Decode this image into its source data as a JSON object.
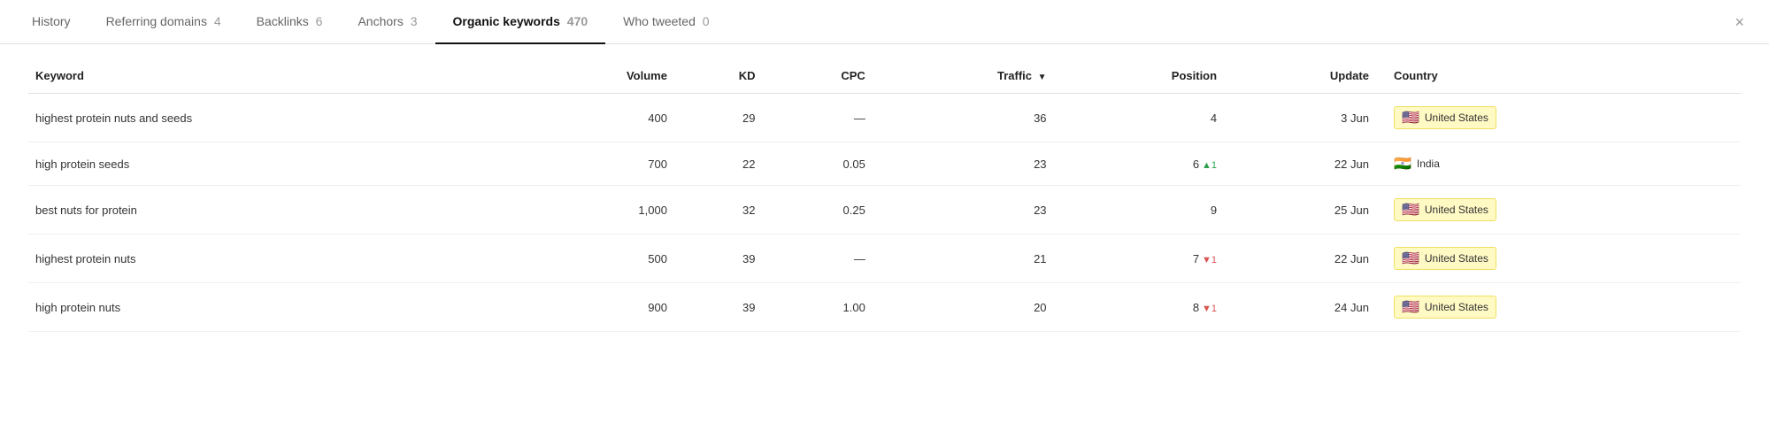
{
  "tabs": [
    {
      "id": "history",
      "label": "History",
      "count": null,
      "active": false
    },
    {
      "id": "referring-domains",
      "label": "Referring domains",
      "count": "4",
      "active": false
    },
    {
      "id": "backlinks",
      "label": "Backlinks",
      "count": "6",
      "active": false
    },
    {
      "id": "anchors",
      "label": "Anchors",
      "count": "3",
      "active": false
    },
    {
      "id": "organic-keywords",
      "label": "Organic keywords",
      "count": "470",
      "active": true
    },
    {
      "id": "who-tweeted",
      "label": "Who tweeted",
      "count": "0",
      "active": false
    }
  ],
  "close_label": "×",
  "table": {
    "columns": [
      {
        "id": "keyword",
        "label": "Keyword",
        "align": "left"
      },
      {
        "id": "volume",
        "label": "Volume",
        "align": "right"
      },
      {
        "id": "kd",
        "label": "KD",
        "align": "right"
      },
      {
        "id": "cpc",
        "label": "CPC",
        "align": "right"
      },
      {
        "id": "traffic",
        "label": "Traffic",
        "sorted": true,
        "sort_dir": "desc",
        "align": "right"
      },
      {
        "id": "position",
        "label": "Position",
        "align": "right"
      },
      {
        "id": "update",
        "label": "Update",
        "align": "right"
      },
      {
        "id": "country",
        "label": "Country",
        "align": "left"
      }
    ],
    "rows": [
      {
        "keyword": "highest protein nuts and seeds",
        "volume": "400",
        "kd": "29",
        "cpc": "—",
        "traffic": "36",
        "position": "4",
        "position_change": null,
        "position_dir": null,
        "update": "3 Jun",
        "country": "United States",
        "country_flag": "🇺🇸",
        "country_highlight": true
      },
      {
        "keyword": "high protein seeds",
        "volume": "700",
        "kd": "22",
        "cpc": "0.05",
        "traffic": "23",
        "position": "6",
        "position_change": "1",
        "position_dir": "up",
        "update": "22 Jun",
        "country": "India",
        "country_flag": "🇮🇳",
        "country_highlight": false
      },
      {
        "keyword": "best nuts for protein",
        "volume": "1,000",
        "kd": "32",
        "cpc": "0.25",
        "traffic": "23",
        "position": "9",
        "position_change": null,
        "position_dir": null,
        "update": "25 Jun",
        "country": "United States",
        "country_flag": "🇺🇸",
        "country_highlight": true
      },
      {
        "keyword": "highest protein nuts",
        "volume": "500",
        "kd": "39",
        "cpc": "—",
        "traffic": "21",
        "position": "7",
        "position_change": "1",
        "position_dir": "down",
        "update": "22 Jun",
        "country": "United States",
        "country_flag": "🇺🇸",
        "country_highlight": true
      },
      {
        "keyword": "high protein nuts",
        "volume": "900",
        "kd": "39",
        "cpc": "1.00",
        "traffic": "20",
        "position": "8",
        "position_change": "1",
        "position_dir": "down",
        "update": "24 Jun",
        "country": "United States",
        "country_flag": "🇺🇸",
        "country_highlight": true
      }
    ]
  }
}
